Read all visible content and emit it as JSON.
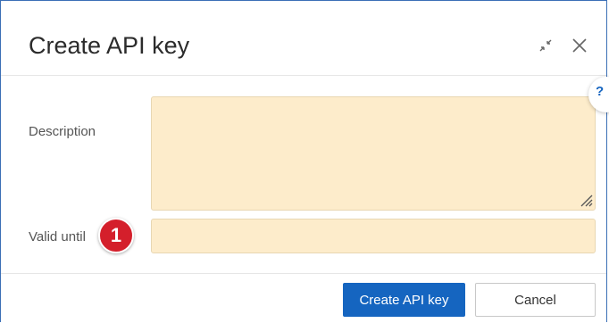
{
  "dialog": {
    "title": "Create API key"
  },
  "header_icons": {
    "minimize": "minimize-icon",
    "close": "close-icon"
  },
  "help": {
    "label": "?"
  },
  "form": {
    "description_label": "Description",
    "description_value": "",
    "valid_until_label": "Valid until",
    "valid_until_value": ""
  },
  "annotation": {
    "badge_number": "1",
    "badge_color": "#d41f2b"
  },
  "footer": {
    "create_label": "Create API key",
    "cancel_label": "Cancel"
  },
  "colors": {
    "primary": "#1565c0",
    "field_background": "#fdeccb",
    "border": "#3b6fb6"
  }
}
